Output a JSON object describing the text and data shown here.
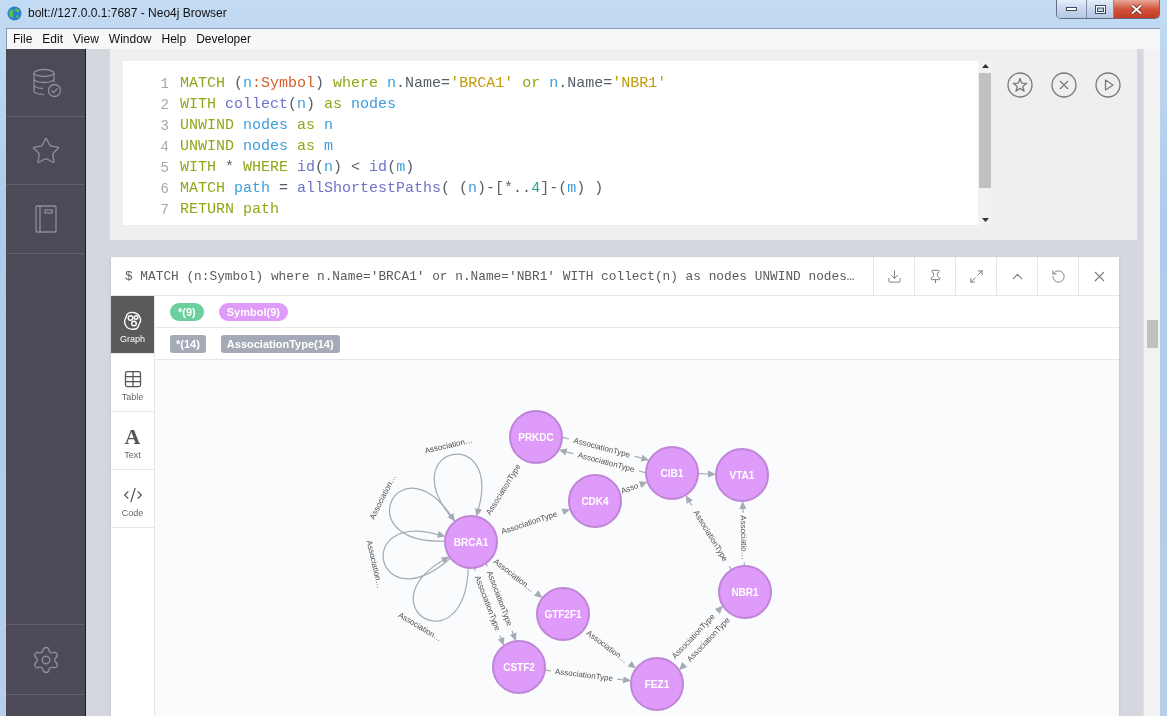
{
  "window": {
    "title": "bolt://127.0.0.1:7687 - Neo4j Browser"
  },
  "menu_bar": [
    "File",
    "Edit",
    "View",
    "Window",
    "Help",
    "Developer"
  ],
  "editor": {
    "lines": [
      {
        "number": "1",
        "tokens": [
          {
            "text": "MATCH ",
            "kind": "keyword"
          },
          {
            "text": "(",
            "kind": "plain"
          },
          {
            "text": "n",
            "kind": "variable"
          },
          {
            "text": ":Symbol",
            "kind": "label"
          },
          {
            "text": ") ",
            "kind": "plain"
          },
          {
            "text": "where ",
            "kind": "keyword"
          },
          {
            "text": "n",
            "kind": "variable"
          },
          {
            "text": ".Name=",
            "kind": "plain"
          },
          {
            "text": "'BRCA1'",
            "kind": "string"
          },
          {
            "text": " or ",
            "kind": "keyword"
          },
          {
            "text": "n",
            "kind": "variable"
          },
          {
            "text": ".Name=",
            "kind": "plain"
          },
          {
            "text": "'NBR1'",
            "kind": "string"
          }
        ]
      },
      {
        "number": "2",
        "tokens": [
          {
            "text": "WITH ",
            "kind": "keyword"
          },
          {
            "text": "collect",
            "kind": "function"
          },
          {
            "text": "(",
            "kind": "plain"
          },
          {
            "text": "n",
            "kind": "variable"
          },
          {
            "text": ") ",
            "kind": "plain"
          },
          {
            "text": "as ",
            "kind": "keyword"
          },
          {
            "text": "nodes",
            "kind": "variable"
          }
        ]
      },
      {
        "number": "3",
        "tokens": [
          {
            "text": "UNWIND ",
            "kind": "keyword"
          },
          {
            "text": "nodes",
            "kind": "variable"
          },
          {
            "text": " as ",
            "kind": "keyword"
          },
          {
            "text": "n",
            "kind": "variable"
          }
        ]
      },
      {
        "number": "4",
        "tokens": [
          {
            "text": "UNWIND ",
            "kind": "keyword"
          },
          {
            "text": "nodes",
            "kind": "variable"
          },
          {
            "text": " as ",
            "kind": "keyword"
          },
          {
            "text": "m",
            "kind": "variable"
          }
        ]
      },
      {
        "number": "5",
        "tokens": [
          {
            "text": "WITH ",
            "kind": "keyword"
          },
          {
            "text": "* ",
            "kind": "plain"
          },
          {
            "text": "WHERE ",
            "kind": "keyword"
          },
          {
            "text": "id",
            "kind": "function"
          },
          {
            "text": "(",
            "kind": "plain"
          },
          {
            "text": "n",
            "kind": "variable"
          },
          {
            "text": ") < ",
            "kind": "plain"
          },
          {
            "text": "id",
            "kind": "function"
          },
          {
            "text": "(",
            "kind": "plain"
          },
          {
            "text": "m",
            "kind": "variable"
          },
          {
            "text": ")",
            "kind": "plain"
          }
        ]
      },
      {
        "number": "6",
        "tokens": [
          {
            "text": "MATCH ",
            "kind": "keyword"
          },
          {
            "text": "path",
            "kind": "variable"
          },
          {
            "text": " = ",
            "kind": "plain"
          },
          {
            "text": "allShortestPaths",
            "kind": "function"
          },
          {
            "text": "( (",
            "kind": "plain"
          },
          {
            "text": "n",
            "kind": "variable"
          },
          {
            "text": ")-[*..",
            "kind": "plain"
          },
          {
            "text": "4",
            "kind": "number"
          },
          {
            "text": "]-(",
            "kind": "plain"
          },
          {
            "text": "m",
            "kind": "variable"
          },
          {
            "text": ") )",
            "kind": "plain"
          }
        ]
      },
      {
        "number": "7",
        "tokens": [
          {
            "text": "RETURN path",
            "kind": "keyword"
          }
        ]
      }
    ]
  },
  "result": {
    "command": "$ MATCH (n:Symbol) where n.Name='BRCA1' or n.Name='NBR1' WITH collect(n) as nodes UNWIND nodes…",
    "view_tabs": [
      {
        "label": "Graph",
        "kind": "graph",
        "selected": true
      },
      {
        "label": "Table",
        "kind": "table",
        "selected": false
      },
      {
        "label": "Text",
        "kind": "text",
        "glyph": "A",
        "selected": false
      },
      {
        "label": "Code",
        "kind": "code",
        "selected": false
      }
    ],
    "node_labels": [
      {
        "text": "*(9)",
        "color": "#6dce9e"
      },
      {
        "text": "Symbol(9)",
        "color": "#de9bf9"
      }
    ],
    "relationship_types": [
      {
        "text": "*(14)"
      },
      {
        "text": "AssociationType(14)"
      }
    ],
    "graph": {
      "nodes": [
        "PRKDC",
        "CIB1",
        "VTA1",
        "CDK4",
        "BRCA1",
        "GTF2F1",
        "NBR1",
        "CSTF2",
        "FEZ1"
      ],
      "relationships": [
        {
          "label": "AssociationType"
        },
        {
          "label": "AssociationType"
        },
        {
          "label": "AssociationType"
        },
        {
          "label": "AssociationType"
        },
        {
          "label": "Asso"
        },
        {
          "label": "AssociationType"
        },
        {
          "label": "Associatio…"
        },
        {
          "label": "AssociationType"
        },
        {
          "label": "AssociationType"
        },
        {
          "label": "AssociationType"
        },
        {
          "label": "Association…"
        },
        {
          "label": "Association…"
        },
        {
          "label": "AssociationType"
        },
        {
          "label": "AssociationType"
        },
        {
          "label": "Association…"
        },
        {
          "label": "Association…"
        },
        {
          "label": "Association…"
        },
        {
          "label": "Association…"
        }
      ]
    }
  }
}
